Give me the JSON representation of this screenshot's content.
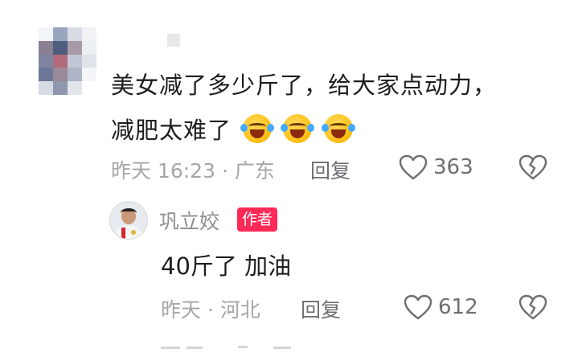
{
  "comment": {
    "text_line1": "美女减了多少斤了，给大家点动力，",
    "text_line2": "减肥太难了",
    "emojis": [
      "laugh-cry-emoji",
      "laugh-cry-emoji",
      "laugh-cry-emoji"
    ],
    "meta": "昨天 16:23 · 广东",
    "reply_label": "回复",
    "like_count": "363"
  },
  "reply": {
    "author_name": "巩立姣",
    "author_badge": "作者",
    "text": "40斤了 加油",
    "meta": "昨天 · 河北",
    "reply_label": "回复",
    "like_count": "612"
  },
  "colors": {
    "text_primary": "#1d1d1f",
    "text_meta": "#a6a6ab",
    "badge_bg": "#ff2a55",
    "icon_gray": "#6e6e73"
  }
}
